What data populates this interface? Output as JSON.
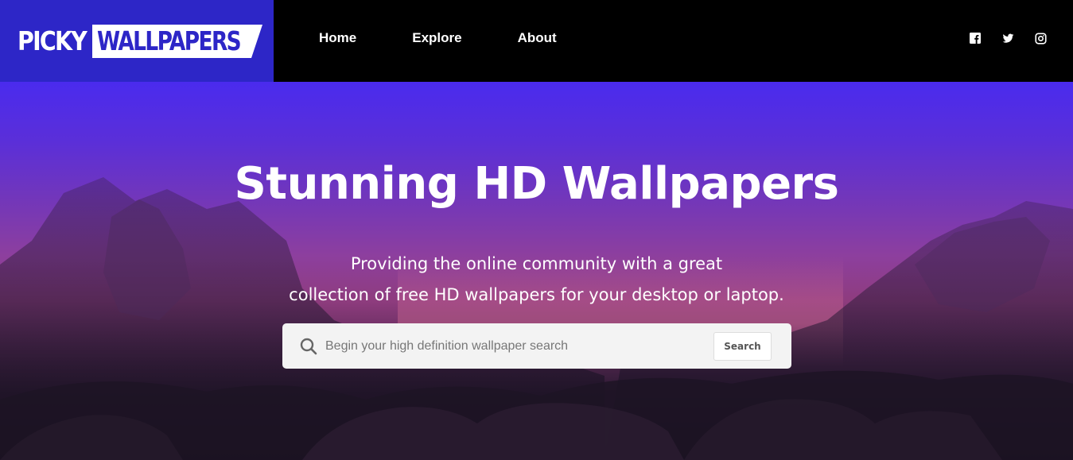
{
  "header": {
    "logo": {
      "word1": "PICKY",
      "word2": "WALLPAPERS"
    },
    "nav": [
      {
        "label": "Home"
      },
      {
        "label": "Explore"
      },
      {
        "label": "About"
      }
    ],
    "social_icons": [
      "facebook-icon",
      "twitter-icon",
      "instagram-icon"
    ]
  },
  "hero": {
    "title": "Stunning HD Wallpapers",
    "subtitle_line1": "Providing the online community with a great",
    "subtitle_line2": "collection of free HD wallpapers for your desktop or laptop.",
    "search": {
      "placeholder": "Begin your high definition wallpaper search",
      "value": "",
      "button_label": "Search"
    }
  },
  "colors": {
    "brand": "#2d26c7",
    "header_bg": "#000000",
    "hero_top": "#4a2bee",
    "hero_bottom": "#1a1220"
  }
}
